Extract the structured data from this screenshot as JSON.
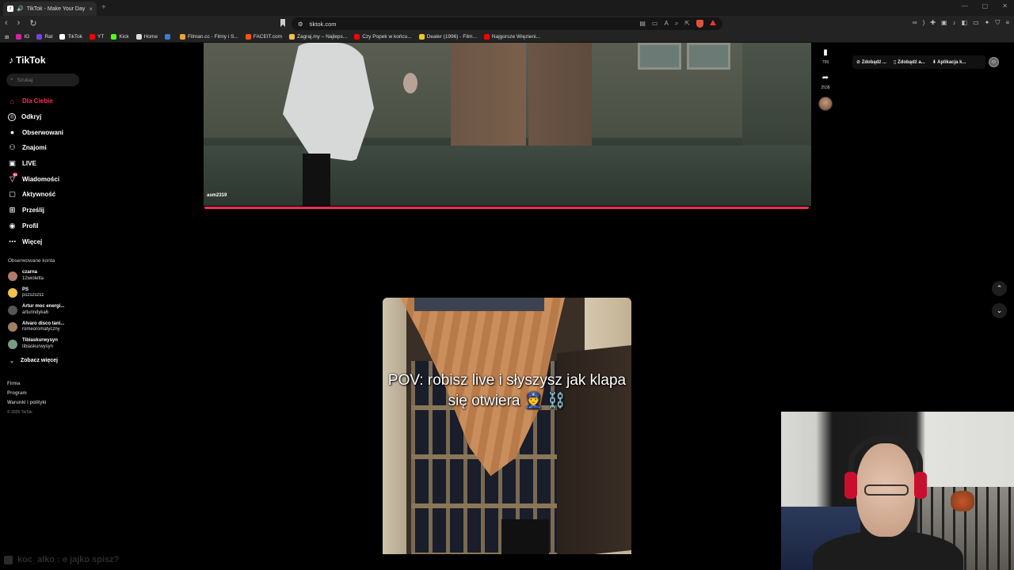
{
  "browser": {
    "tab_title": "TikTok - Make Your Day",
    "tab_close": "×",
    "new_tab": "+",
    "url": "tiktok.com",
    "window_controls": [
      "—",
      "▢",
      "✕"
    ],
    "nav": {
      "back": "‹",
      "forward": "›",
      "reload": "↻"
    },
    "bookmarks": [
      {
        "label": "IG",
        "color": "#d6249f"
      },
      {
        "label": "Rat",
        "color": "#7b3fe4"
      },
      {
        "label": "TikTok",
        "color": "#ffffff"
      },
      {
        "label": "YT",
        "color": "#ff0000"
      },
      {
        "label": "Kick",
        "color": "#53fc18"
      },
      {
        "label": "Home",
        "color": "#dddddd"
      },
      {
        "label": "",
        "color": "#3a7bd5"
      },
      {
        "label": "Filman.cc - Filmy i S...",
        "color": "#e8a33c"
      },
      {
        "label": "FACEIT.com",
        "color": "#ff5500"
      },
      {
        "label": "Zagraj.my – Najleps...",
        "color": "#f2c14e"
      },
      {
        "label": "Czy Popek w końcu...",
        "color": "#ff0000"
      },
      {
        "label": "Dealer (1996) - Film...",
        "color": "#f5c518"
      },
      {
        "label": "Najgorsze Więzieni...",
        "color": "#ff0000"
      }
    ]
  },
  "sidebar": {
    "logo": "TikTok",
    "search_placeholder": "Szukaj",
    "nav": [
      {
        "label": "Dla Ciebie",
        "icon": "home-icon",
        "glyph": "⌂",
        "active": true
      },
      {
        "label": "Odkryj",
        "icon": "compass-icon",
        "glyph": "◎"
      },
      {
        "label": "Obserwowani",
        "icon": "following-icon",
        "glyph": "●"
      },
      {
        "label": "Znajomi",
        "icon": "friends-icon",
        "glyph": "⚇"
      },
      {
        "label": "LIVE",
        "icon": "live-icon",
        "glyph": "▣"
      },
      {
        "label": "Wiadomości",
        "icon": "messages-icon",
        "glyph": "▽",
        "badge": "84"
      },
      {
        "label": "Aktywność",
        "icon": "activity-icon",
        "glyph": "▢"
      },
      {
        "label": "Prześlij",
        "icon": "upload-icon",
        "glyph": "⊞"
      },
      {
        "label": "Profil",
        "icon": "profile-icon",
        "glyph": "◉"
      },
      {
        "label": "Więcej",
        "icon": "more-icon",
        "glyph": "⋯"
      }
    ],
    "followed_header": "Obserwowane konta",
    "followed": [
      {
        "name": "czarna",
        "handle": "12wioletta",
        "color": "#b07a6a"
      },
      {
        "name": "PS",
        "handle": "pszszszsz",
        "color": "#f2c14e"
      },
      {
        "name": "Artur moc energi...",
        "handle": "arturindyka6",
        "color": "#555555"
      },
      {
        "name": "Alvaro disco tani...",
        "handle": "romeoromatyczny",
        "color": "#a08060"
      },
      {
        "name": "Tibiaskurwysyn",
        "handle": "tibiaskurwysyn",
        "color": "#7a9a88"
      }
    ],
    "see_more": "Zobacz więcej",
    "footer": [
      "Firma",
      "Program",
      "Warunki i polityki"
    ],
    "copyright": "© 2025 TikTok"
  },
  "feed": {
    "video1": {
      "username": "asm2319",
      "progress": 1.0
    },
    "actions": [
      {
        "icon": "bookmark-icon",
        "glyph": "🔖",
        "count": "799"
      },
      {
        "icon": "share-icon",
        "glyph": "➦",
        "count": "2538"
      }
    ],
    "video2": {
      "caption": "POV: robisz live i słyszysz jak klapa się otwiera 👮 ⛓️"
    }
  },
  "header": {
    "actions": [
      "Zdobądź ...",
      "Zdobądź a...",
      "Aplikacja k..."
    ]
  },
  "overlay": {
    "chat_text": "koc_alko : e jajko spisz?"
  }
}
